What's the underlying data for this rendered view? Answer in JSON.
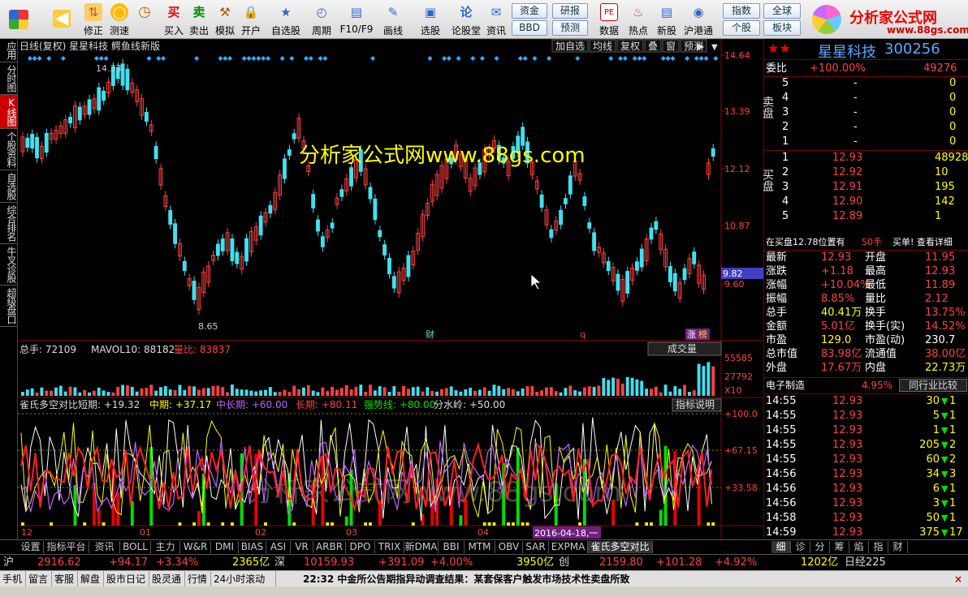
{
  "toolbar": {
    "buttons": [
      {
        "label": "",
        "icon": "back-icon"
      },
      {
        "label": "修正",
        "icon": "up-down-icon"
      },
      {
        "label": "测速",
        "icon": "speed-icon"
      },
      {
        "label": "",
        "icon": "clock-icon"
      },
      {
        "label": "买入",
        "glyph": "买"
      },
      {
        "label": "卖出",
        "glyph": "卖"
      },
      {
        "label": "模拟",
        "icon": "hammer-icon"
      },
      {
        "label": "开户",
        "icon": "lock-icon"
      },
      {
        "label": "自选股",
        "icon": "star-icon"
      },
      {
        "label": "周期",
        "icon": "period-icon"
      },
      {
        "label": "F10/F9",
        "icon": "f10-icon"
      },
      {
        "label": "画线",
        "icon": "pen-icon"
      },
      {
        "label": "选股",
        "icon": "select-icon"
      },
      {
        "label": "论股堂",
        "glyph": "论"
      },
      {
        "label": "资讯",
        "icon": "news-icon"
      },
      {
        "label": "数据",
        "glyph": "PE"
      },
      {
        "label": "热点",
        "icon": "fire-icon"
      },
      {
        "label": "新股",
        "icon": "new-icon"
      },
      {
        "label": "沪港通",
        "icon": "hk-icon"
      }
    ],
    "square_buttons": [
      "资金",
      "BBD",
      "研报",
      "预测",
      "指数",
      "个股",
      "全球",
      "板块"
    ]
  },
  "logo": {
    "text": "分析家公式网",
    "url": "www.88gs.com"
  },
  "left_tabs": [
    "应用",
    "分时图",
    "K线图",
    "个股资料",
    "自选股",
    "综合排名",
    "牛叉诊股",
    "超级盘口"
  ],
  "chart": {
    "header": "日线(复权) 星星科技 鳄鱼线新版",
    "header_buttons": [
      "加自选",
      "均线",
      "复权",
      "叠",
      "窗",
      "预测"
    ],
    "watermark1": "分析家公式网www.88gs.com",
    "watermark2": "分析家公式网www.88gs.com",
    "high_label": "14.33",
    "low_label": "8.65",
    "price_axis": [
      "14.64",
      "13.39",
      "12.12",
      "10.87",
      "9.60"
    ],
    "price_marker": "9.82",
    "event1": "财",
    "event2": "q",
    "event3": "涨",
    "event4": "榜",
    "vol_title": "总手: 72109",
    "mavol": "MAVOL10: 88182",
    "volratio": "量比: 83837",
    "vol_btn": "成交量",
    "vol_axis": [
      "55585",
      "27792",
      "X10"
    ],
    "ind_title": "雀氏多空对比",
    "ind_short": "短期: +19.32",
    "ind_mid": "中期: +37.17",
    "ind_midlong": "中长期: +60.00",
    "ind_long": "长期: +80.11",
    "ind_strong": "强势线: +80.00",
    "ind_split": "分水岭: +50.00",
    "ind_btn": "指标说明",
    "ind_axis": [
      "+100.0",
      "+67.15",
      "+33.58"
    ],
    "x_labels": [
      "12",
      "01",
      "02",
      "03",
      "04"
    ],
    "date_tip": "2016-04-18,一"
  },
  "stock": {
    "name": "星星科技",
    "code": "300256"
  },
  "quote": {
    "wb_label": "委比",
    "wb": "+100.00%",
    "wc": "49276",
    "sell_label": "卖盘",
    "buy_label": "买盘",
    "sell": [
      {
        "n": "5",
        "p": "-",
        "v": "0"
      },
      {
        "n": "4",
        "p": "-",
        "v": "0"
      },
      {
        "n": "3",
        "p": "-",
        "v": "0"
      },
      {
        "n": "2",
        "p": "-",
        "v": "0"
      },
      {
        "n": "1",
        "p": "-",
        "v": "0"
      }
    ],
    "buy": [
      {
        "n": "1",
        "p": "12.93",
        "v": "48928"
      },
      {
        "n": "2",
        "p": "12.92",
        "v": "10"
      },
      {
        "n": "3",
        "p": "12.91",
        "v": "195"
      },
      {
        "n": "4",
        "p": "12.90",
        "v": "142"
      },
      {
        "n": "5",
        "p": "12.89",
        "v": "1"
      }
    ],
    "note": "在买盘12.78位置有",
    "note_qty": "50手",
    "note_link": "买单! 查看详细"
  },
  "stats": [
    {
      "l1": "最新",
      "v1": "12.93",
      "l2": "开盘",
      "v2": "11.95"
    },
    {
      "l1": "涨跌",
      "v1": "+1.18",
      "l2": "最高",
      "v2": "12.93"
    },
    {
      "l1": "涨幅",
      "v1": "+10.04%",
      "l2": "最低",
      "v2": "11.89"
    },
    {
      "l1": "振幅",
      "v1": "8.85%",
      "l2": "量比",
      "v2": "2.12"
    },
    {
      "l1": "总手",
      "v1": "40.41万",
      "l2": "换手",
      "v2": "13.75%"
    },
    {
      "l1": "金额",
      "v1": "5.01亿",
      "l2": "换手(实)",
      "v2": "14.52%"
    },
    {
      "l1": "市盈",
      "v1": "129.0",
      "l2": "市盈(动)",
      "v2": "230.7"
    },
    {
      "l1": "总市值",
      "v1": "83.98亿",
      "l2": "流通值",
      "v2": "38.00亿"
    },
    {
      "l1": "外盘",
      "v1": "17.67万",
      "l2": "内盘",
      "v2": "22.73万"
    }
  ],
  "industry": {
    "name": "电子制造",
    "pct": "4.95%",
    "btn": "同行业比较"
  },
  "ticks": [
    {
      "t": "14:55",
      "p": "12.93",
      "v": "30",
      "n": "1"
    },
    {
      "t": "14:55",
      "p": "12.93",
      "v": "5",
      "n": "1"
    },
    {
      "t": "14:55",
      "p": "12.93",
      "v": "1",
      "n": "1"
    },
    {
      "t": "14:55",
      "p": "12.93",
      "v": "205",
      "n": "2"
    },
    {
      "t": "14:55",
      "p": "12.93",
      "v": "60",
      "n": "2"
    },
    {
      "t": "14:56",
      "p": "12.93",
      "v": "34",
      "n": "3"
    },
    {
      "t": "14:56",
      "p": "12.93",
      "v": "6",
      "n": "1"
    },
    {
      "t": "14:56",
      "p": "12.93",
      "v": "3",
      "n": "1"
    },
    {
      "t": "14:58",
      "p": "12.93",
      "v": "50",
      "n": "1"
    },
    {
      "t": "14:59",
      "p": "12.93",
      "v": "375",
      "n": "17"
    }
  ],
  "right_tabs": [
    "细",
    "诊",
    "分",
    "筹",
    "焰",
    "指",
    "财"
  ],
  "bottom_tabs": [
    "设置",
    "指标平台",
    "资讯",
    "BOLL",
    "主力",
    "W&R",
    "DMI",
    "BIAS",
    "ASI",
    "VR",
    "ARBR",
    "DPO",
    "TRIX",
    "新DMA",
    "BBI",
    "MTM",
    "OBV",
    "SAR",
    "EXPMA",
    "雀氏多空对比"
  ],
  "index_bar": {
    "sh": "沪",
    "sh_v": "2916.62",
    "sh_c": "+94.17",
    "sh_p": "+3.34%",
    "sh_a": "2365亿",
    "sz": "深",
    "sz_v": "10159.93",
    "sz_c": "+391.09",
    "sz_p": "+4.00%",
    "sz_a": "3950亿",
    "cy": "创",
    "cy_v": "2159.80",
    "cy_c": "+101.28",
    "cy_p": "+4.92%",
    "cy_a": "1202亿",
    "nk": "日经225"
  },
  "status": {
    "items": [
      "手机",
      "留言",
      "客服",
      "解盘",
      "股市日记",
      "股灵通",
      "行情",
      "24小时滚动"
    ],
    "news": "22:32 中金所公告期指异动调查结果：某套保客户触发市场技术性卖盘所致"
  }
}
